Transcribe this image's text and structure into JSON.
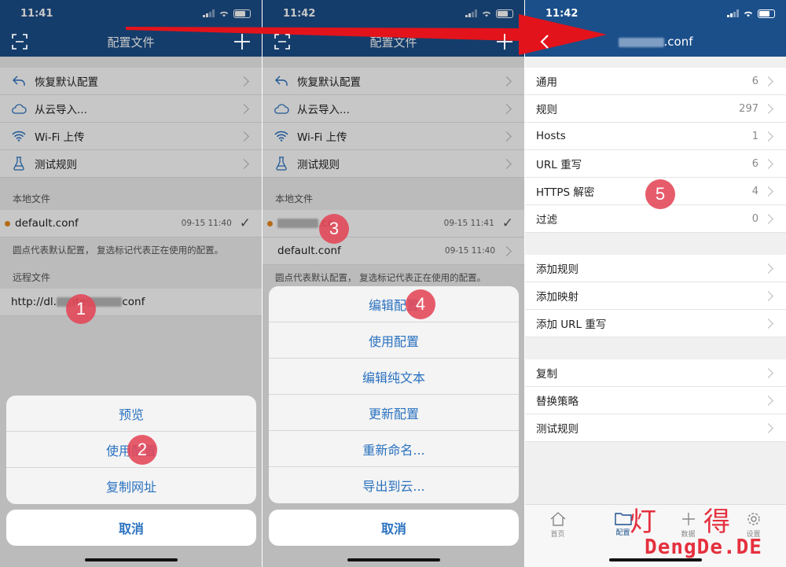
{
  "panel1": {
    "time": "11:41",
    "title": "配置文件",
    "menu": [
      "恢复默认配置",
      "从云导入...",
      "Wi-Fi 上传",
      "测试规则"
    ],
    "local_header": "本地文件",
    "file_name": "default.conf",
    "file_time": "09-15 11:40",
    "note": "圆点代表默认配置， 复选标记代表正在使用的配置。",
    "remote_header": "远程文件",
    "remote_prefix": "http://dl.",
    "remote_mid": "ite",
    "remote_suffix": "conf",
    "sheet": [
      "预览",
      "使用配置",
      "复制网址"
    ],
    "cancel": "取消",
    "badges": [
      "1",
      "2"
    ]
  },
  "panel2": {
    "time": "11:42",
    "title": "配置文件",
    "menu": [
      "恢复默认配置",
      "从云导入...",
      "Wi-Fi 上传",
      "测试规则"
    ],
    "local_header": "本地文件",
    "file1_suffix": ".co",
    "file1_time": "09-15 11:41",
    "file2_name": "default.conf",
    "file2_time": "09-15 11:40",
    "note": "圆点代表默认配置， 复选标记代表正在使用的配置。",
    "sheet": [
      "编辑配置",
      "使用配置",
      "编辑纯文本",
      "更新配置",
      "重新命名...",
      "导出到云..."
    ],
    "cancel": "取消",
    "badges": [
      "3",
      "4"
    ]
  },
  "panel3": {
    "time": "11:42",
    "title_suffix": ".conf",
    "group1": [
      {
        "label": "通用",
        "value": "6"
      },
      {
        "label": "规则",
        "value": "297"
      },
      {
        "label": "Hosts",
        "value": "1"
      },
      {
        "label": "URL 重写",
        "value": "6"
      },
      {
        "label": "HTTPS 解密",
        "value": "4"
      },
      {
        "label": "过滤",
        "value": "0"
      }
    ],
    "group2": [
      "添加规则",
      "添加映射",
      "添加 URL 重写"
    ],
    "group3": [
      "复制",
      "替换策略",
      "测试规则"
    ],
    "tabs": [
      "首页",
      "配置",
      "数据",
      "设置"
    ],
    "badge": "5"
  },
  "watermark": {
    "cn1": "灯",
    "cn2": "得",
    "en": "DengDe.DE"
  },
  "colors": {
    "navbar": "#1b4f8a",
    "link": "#2a72c0",
    "badge": "#e44656",
    "arrow": "#e3131b"
  }
}
